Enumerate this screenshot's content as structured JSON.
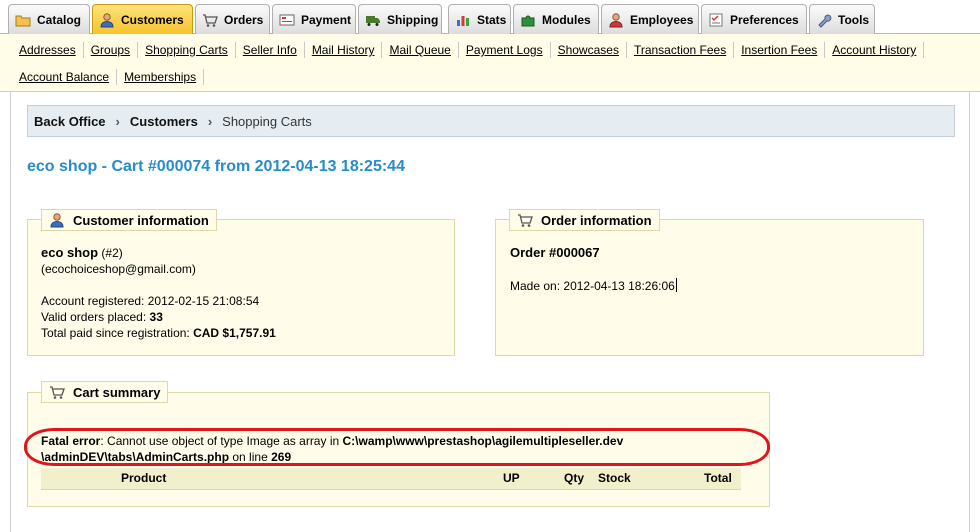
{
  "tabs": [
    {
      "label": "Catalog",
      "icon": "folder-icon",
      "active": false
    },
    {
      "label": "Customers",
      "icon": "customer-icon",
      "active": true
    },
    {
      "label": "Orders",
      "icon": "cart-icon",
      "active": false
    },
    {
      "label": "Payment",
      "icon": "payment-icon",
      "active": false
    },
    {
      "label": "Shipping",
      "icon": "truck-icon",
      "active": false
    },
    {
      "label": "Stats",
      "icon": "stats-icon",
      "active": false
    },
    {
      "label": "Modules",
      "icon": "puzzle-icon",
      "active": false
    },
    {
      "label": "Employees",
      "icon": "employee-icon",
      "active": false
    },
    {
      "label": "Preferences",
      "icon": "preferences-icon",
      "active": false
    },
    {
      "label": "Tools",
      "icon": "wrench-icon",
      "active": false
    }
  ],
  "submenu": {
    "row1": [
      "Addresses",
      "Groups",
      "Shopping Carts",
      "Seller Info",
      "Mail History",
      "Mail Queue",
      "Payment Logs",
      "Showcases",
      "Transaction Fees",
      "Insertion Fees",
      "Account History"
    ],
    "row2": [
      "Account Balance",
      "Memberships"
    ]
  },
  "breadcrumb": {
    "home": "Back Office",
    "section": "Customers",
    "current": "Shopping Carts",
    "separator": "›"
  },
  "page_title": "eco shop - Cart #000074 from 2012-04-13 18:25:44",
  "customer": {
    "legend": "Customer information",
    "name": "eco shop",
    "id": "(#2)",
    "email": "(ecochoiceshop@gmail.com)",
    "registered_label": "Account registered:",
    "registered_value": "2012-02-15 21:08:54",
    "valid_orders_label": "Valid orders placed:",
    "valid_orders_value": "33",
    "total_paid_label": "Total paid since registration:",
    "total_paid_value": "CAD $1,757.91"
  },
  "order": {
    "legend": "Order information",
    "number": "Order #000067",
    "made_on_label": "Made on:",
    "made_on_value": "2012-04-13 18:26:06"
  },
  "cart": {
    "legend": "Cart summary",
    "error_label": "Fatal error",
    "error_message": ": Cannot use object of type Image as array in",
    "error_path1": "C:\\wamp\\www\\prestashop\\agilemultipleseller.dev",
    "error_path2": "\\adminDEV\\tabs\\AdminCarts.php",
    "error_online": "on line",
    "error_line": "269",
    "columns": [
      "Product",
      "UP",
      "Qty",
      "Stock",
      "Total"
    ]
  },
  "colors": {
    "accent_title": "#268ccd",
    "active_tab": "#f5c22a",
    "error_outline": "#e0141c",
    "panel_bg": "#fffde9"
  }
}
